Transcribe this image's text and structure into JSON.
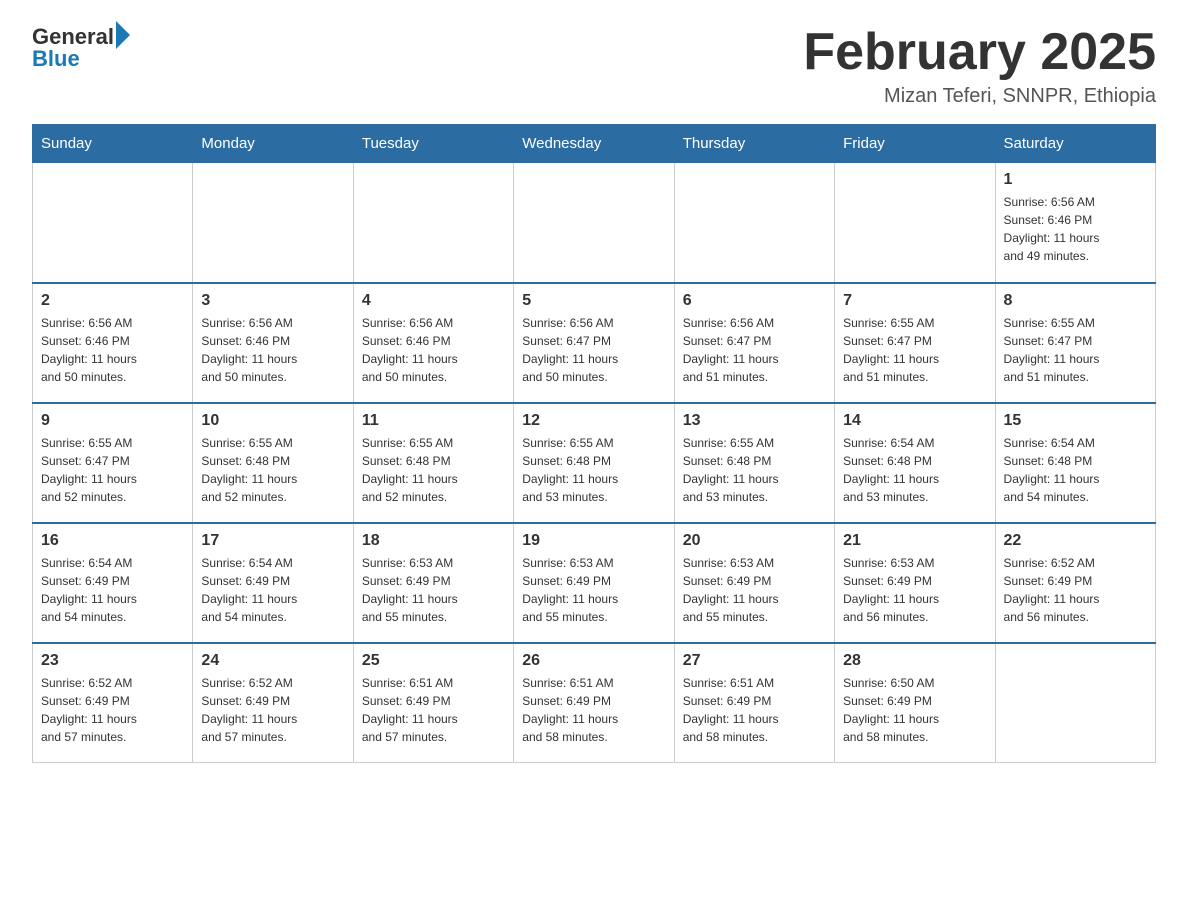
{
  "logo": {
    "general": "General",
    "blue": "Blue"
  },
  "header": {
    "month_title": "February 2025",
    "subtitle": "Mizan Teferi, SNNPR, Ethiopia"
  },
  "days_of_week": [
    "Sunday",
    "Monday",
    "Tuesday",
    "Wednesday",
    "Thursday",
    "Friday",
    "Saturday"
  ],
  "weeks": [
    [
      {
        "day": "",
        "info": ""
      },
      {
        "day": "",
        "info": ""
      },
      {
        "day": "",
        "info": ""
      },
      {
        "day": "",
        "info": ""
      },
      {
        "day": "",
        "info": ""
      },
      {
        "day": "",
        "info": ""
      },
      {
        "day": "1",
        "info": "Sunrise: 6:56 AM\nSunset: 6:46 PM\nDaylight: 11 hours\nand 49 minutes."
      }
    ],
    [
      {
        "day": "2",
        "info": "Sunrise: 6:56 AM\nSunset: 6:46 PM\nDaylight: 11 hours\nand 50 minutes."
      },
      {
        "day": "3",
        "info": "Sunrise: 6:56 AM\nSunset: 6:46 PM\nDaylight: 11 hours\nand 50 minutes."
      },
      {
        "day": "4",
        "info": "Sunrise: 6:56 AM\nSunset: 6:46 PM\nDaylight: 11 hours\nand 50 minutes."
      },
      {
        "day": "5",
        "info": "Sunrise: 6:56 AM\nSunset: 6:47 PM\nDaylight: 11 hours\nand 50 minutes."
      },
      {
        "day": "6",
        "info": "Sunrise: 6:56 AM\nSunset: 6:47 PM\nDaylight: 11 hours\nand 51 minutes."
      },
      {
        "day": "7",
        "info": "Sunrise: 6:55 AM\nSunset: 6:47 PM\nDaylight: 11 hours\nand 51 minutes."
      },
      {
        "day": "8",
        "info": "Sunrise: 6:55 AM\nSunset: 6:47 PM\nDaylight: 11 hours\nand 51 minutes."
      }
    ],
    [
      {
        "day": "9",
        "info": "Sunrise: 6:55 AM\nSunset: 6:47 PM\nDaylight: 11 hours\nand 52 minutes."
      },
      {
        "day": "10",
        "info": "Sunrise: 6:55 AM\nSunset: 6:48 PM\nDaylight: 11 hours\nand 52 minutes."
      },
      {
        "day": "11",
        "info": "Sunrise: 6:55 AM\nSunset: 6:48 PM\nDaylight: 11 hours\nand 52 minutes."
      },
      {
        "day": "12",
        "info": "Sunrise: 6:55 AM\nSunset: 6:48 PM\nDaylight: 11 hours\nand 53 minutes."
      },
      {
        "day": "13",
        "info": "Sunrise: 6:55 AM\nSunset: 6:48 PM\nDaylight: 11 hours\nand 53 minutes."
      },
      {
        "day": "14",
        "info": "Sunrise: 6:54 AM\nSunset: 6:48 PM\nDaylight: 11 hours\nand 53 minutes."
      },
      {
        "day": "15",
        "info": "Sunrise: 6:54 AM\nSunset: 6:48 PM\nDaylight: 11 hours\nand 54 minutes."
      }
    ],
    [
      {
        "day": "16",
        "info": "Sunrise: 6:54 AM\nSunset: 6:49 PM\nDaylight: 11 hours\nand 54 minutes."
      },
      {
        "day": "17",
        "info": "Sunrise: 6:54 AM\nSunset: 6:49 PM\nDaylight: 11 hours\nand 54 minutes."
      },
      {
        "day": "18",
        "info": "Sunrise: 6:53 AM\nSunset: 6:49 PM\nDaylight: 11 hours\nand 55 minutes."
      },
      {
        "day": "19",
        "info": "Sunrise: 6:53 AM\nSunset: 6:49 PM\nDaylight: 11 hours\nand 55 minutes."
      },
      {
        "day": "20",
        "info": "Sunrise: 6:53 AM\nSunset: 6:49 PM\nDaylight: 11 hours\nand 55 minutes."
      },
      {
        "day": "21",
        "info": "Sunrise: 6:53 AM\nSunset: 6:49 PM\nDaylight: 11 hours\nand 56 minutes."
      },
      {
        "day": "22",
        "info": "Sunrise: 6:52 AM\nSunset: 6:49 PM\nDaylight: 11 hours\nand 56 minutes."
      }
    ],
    [
      {
        "day": "23",
        "info": "Sunrise: 6:52 AM\nSunset: 6:49 PM\nDaylight: 11 hours\nand 57 minutes."
      },
      {
        "day": "24",
        "info": "Sunrise: 6:52 AM\nSunset: 6:49 PM\nDaylight: 11 hours\nand 57 minutes."
      },
      {
        "day": "25",
        "info": "Sunrise: 6:51 AM\nSunset: 6:49 PM\nDaylight: 11 hours\nand 57 minutes."
      },
      {
        "day": "26",
        "info": "Sunrise: 6:51 AM\nSunset: 6:49 PM\nDaylight: 11 hours\nand 58 minutes."
      },
      {
        "day": "27",
        "info": "Sunrise: 6:51 AM\nSunset: 6:49 PM\nDaylight: 11 hours\nand 58 minutes."
      },
      {
        "day": "28",
        "info": "Sunrise: 6:50 AM\nSunset: 6:49 PM\nDaylight: 11 hours\nand 58 minutes."
      },
      {
        "day": "",
        "info": ""
      }
    ]
  ]
}
